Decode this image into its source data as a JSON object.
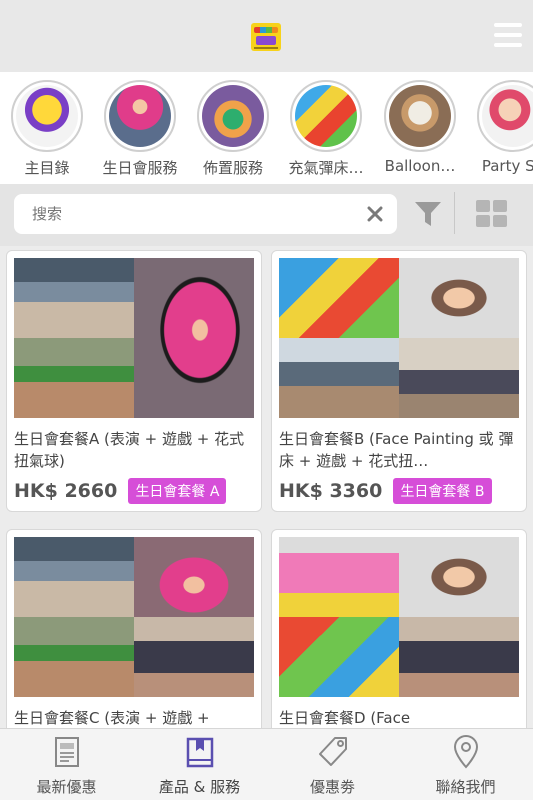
{
  "header": {
    "logo": "logo",
    "menu_icon": "hamburger-menu-icon"
  },
  "categories": [
    {
      "label": "主目錄",
      "bg": "radial-gradient(circle at 50% 40%, #ffd83a 0 30%, #7a3fc6 31% 45%, #f3f3f3 46%)"
    },
    {
      "label": "生日會服務",
      "bg": "radial-gradient(circle at 50% 35%, #f4c7a4 0 14%, #e03c8a 15% 45%, #5a6d8c 46%)"
    },
    {
      "label": "佈置服務",
      "bg": "radial-gradient(circle at 50% 55%, #2dae6e 0 22%, #f0a24a 23% 40%, #7a5b9e 41%)"
    },
    {
      "label": "充氣彈床…",
      "bg": "linear-gradient(135deg, #3fa9e8 0 30%, #f2d23a 30% 50%, #e9432f 50% 70%, #5fc24a 70%)"
    },
    {
      "label": "Balloon…",
      "bg": "radial-gradient(circle at 50% 45%, #f0ede4 0 25%, #c89a6a 26% 40%, #8a6d55 41%)"
    },
    {
      "label": "Party Sh",
      "bg": "radial-gradient(circle at 45% 40%, #f6d2b8 0 22%, #e04a6b 23% 40%, #f2f2f2 41%)"
    }
  ],
  "search": {
    "placeholder": "搜索",
    "clear_icon": "close-icon",
    "filter_icon": "filter-icon",
    "view_icon": "grid-view-icon"
  },
  "products": [
    {
      "title": "生日會套餐A (表演 + 遊戲 + 花式扭氣球)",
      "price": "HK$ 2660",
      "tag": "生日會套餐 A"
    },
    {
      "title": "生日會套餐B (Face Painting 或 彈床 + 遊戲 + 花式扭…",
      "price": "HK$ 3360",
      "tag": "生日會套餐 B"
    },
    {
      "title": "生日會套餐C (表演 + 遊戲 +",
      "price": "",
      "tag": ""
    },
    {
      "title": "生日會套餐D (Face",
      "price": "",
      "tag": ""
    }
  ],
  "nav": [
    {
      "label": "最新優惠",
      "icon": "newspaper-icon"
    },
    {
      "label": "產品 & 服務",
      "icon": "book-icon"
    },
    {
      "label": "優惠劵",
      "icon": "tag-icon"
    },
    {
      "label": "聯絡我們",
      "icon": "location-pin-icon"
    }
  ],
  "colors": {
    "accent": "#d64ed8",
    "active_nav": "#5a4fb0"
  }
}
